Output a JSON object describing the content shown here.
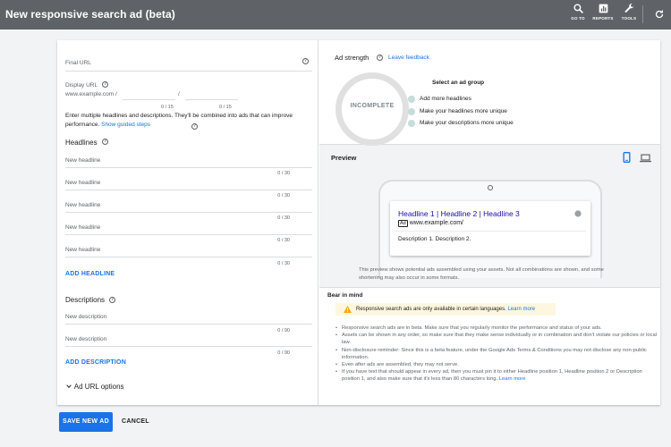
{
  "header": {
    "title": "New responsive search ad (beta)",
    "goto_label": "GO TO",
    "reports_label": "REPORTS",
    "tools_label": "TOOLS"
  },
  "form": {
    "final_url_label": "Final URL",
    "display_url_label": "Display URL",
    "display_url_prefix": "www.example.com /",
    "display_url_sep": "/",
    "path1_counter": "0 / 15",
    "path2_counter": "0 / 15",
    "intro_text": "Enter multiple headlines and descriptions. They'll be combined into ads that can improve performance.",
    "guided_steps_link": "Show guided steps",
    "headlines_title": "Headlines",
    "headlines": [
      {
        "placeholder": "New headline",
        "counter": "0 / 30"
      },
      {
        "placeholder": "New headline",
        "counter": "0 / 30"
      },
      {
        "placeholder": "New headline",
        "counter": "0 / 30"
      },
      {
        "placeholder": "New headline",
        "counter": "0 / 30"
      },
      {
        "placeholder": "New headline",
        "counter": "0 / 30"
      }
    ],
    "add_headline_label": "ADD HEADLINE",
    "descriptions_title": "Descriptions",
    "descriptions": [
      {
        "placeholder": "New description",
        "counter": "0 / 90"
      },
      {
        "placeholder": "New description",
        "counter": "0 / 90"
      }
    ],
    "add_description_label": "ADD DESCRIPTION",
    "ad_url_options_label": "Ad URL options"
  },
  "strength": {
    "title": "Ad strength",
    "feedback_link": "Leave feedback",
    "status": "INCOMPLETE",
    "select_group": "Select an ad group",
    "suggestions": [
      "Add more headlines",
      "Make your headlines more unique",
      "Make your descriptions more unique"
    ],
    "dot_color": "#c6ddd9"
  },
  "preview": {
    "title": "Preview",
    "ad_headline": "Headline 1 | Headline 2 | Headline 3",
    "ad_badge": "Ad",
    "ad_url": "www.example.com/",
    "ad_description": "Description 1. Description 2.",
    "note": "This preview shows potential ads assembled using your assets. Not all combinations are shown, and some shortening may also occur in some formats."
  },
  "bear_in_mind": {
    "title": "Bear in mind",
    "warning_text": "Responsive search ads are only available in certain languages.",
    "warning_link": "Learn more",
    "bullets": [
      "Responsive search ads are in beta. Make sure that you regularly monitor the performance and status of your ads.",
      "Assets can be shown in any order, so make sure that they make sense individually or in combination and don't violate our policies or local law.",
      "Non-disclosure reminder: Since this is a beta feature, under the Google Ads Terms & Conditions you may not disclose any non-public information.",
      "Even after ads are assembled, they may not serve."
    ],
    "last_bullet": "If you have text that should appear in every ad, then you must pin it to either Headline position 1, Headline position 2 or Description position 1, and also make sure that it's less than 80 characters long.",
    "last_link": "Learn more"
  },
  "actions": {
    "save_label": "SAVE NEW AD",
    "cancel_label": "CANCEL"
  },
  "colors": {
    "accent": "#1a73e8",
    "topbar": "#5f6368",
    "warning_bg": "#fef7e0",
    "warning_icon": "#f9ab00"
  }
}
